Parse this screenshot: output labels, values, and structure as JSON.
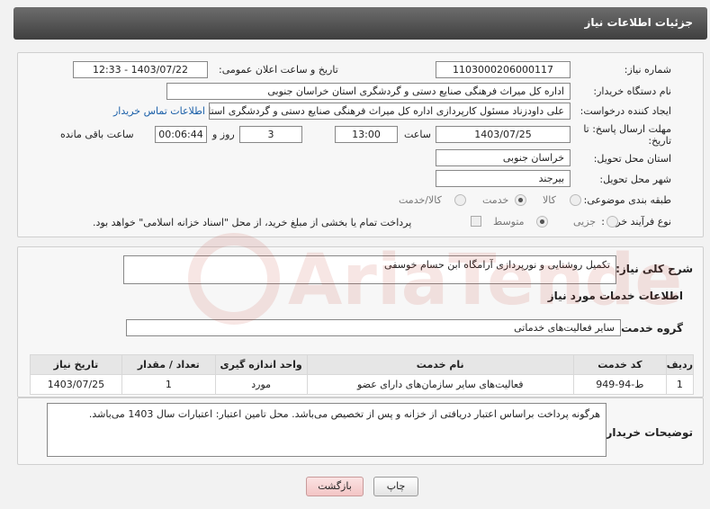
{
  "header": {
    "title": "جزئیات اطلاعات نیاز"
  },
  "form": {
    "need_number_label": "شماره نیاز:",
    "need_number": "1103000206000117",
    "announce_label": "تاریخ و ساعت اعلان عمومی:",
    "announce_value": "1403/07/22 - 12:33",
    "buyer_org_label": "نام دستگاه خریدار:",
    "buyer_org": "اداره کل میراث فرهنگی  صنایع دستی و گردشگری استان خراسان جنوبی",
    "creator_label": "ایجاد کننده درخواست:",
    "creator": "علی داودزناد مسئول کارپردازی اداره کل میراث فرهنگی  صنایع دستی و گردشگری استان خراسان جنوبی",
    "contact_link": "اطلاعات تماس خریدار",
    "deadline_label_1": "مهلت ارسال پاسخ: تا",
    "deadline_label_2": "تاریخ:",
    "deadline_date": "1403/07/25",
    "time_label": "ساعت",
    "deadline_time": "13:00",
    "days_value": "3",
    "days_label": "روز و",
    "remaining_time": "00:06:44",
    "remaining_label": "ساعت باقی مانده",
    "province_label": "استان محل تحویل:",
    "province": "خراسان جنوبی",
    "city_label": "شهر محل تحویل:",
    "city": "بیرجند",
    "category_label": "طبقه بندی موضوعی:",
    "category_options": [
      "کالا",
      "خدمت",
      "کالا/خدمت"
    ],
    "category_selected": 1,
    "process_label": "نوع فرآیند خرید :",
    "process_options": [
      "جزیی",
      "متوسط"
    ],
    "process_selected": 1,
    "payment_text": "پرداخت تمام یا بخشی از مبلغ خرید، از محل \"اسناد خزانه اسلامی\" خواهد بود."
  },
  "summary": {
    "label": "شرح کلی نیاز:",
    "value": "تکمیل روشنایی و نورپردازی آرامگاه ابن حسام خوسفی"
  },
  "services": {
    "section_title": "اطلاعات خدمات مورد نیاز",
    "group_label": "گروه خدمت:",
    "group_value": "سایر فعالیت‌های خدماتی",
    "columns": [
      "ردیف",
      "کد خدمت",
      "نام خدمت",
      "واحد اندازه گیری",
      "تعداد / مقدار",
      "تاریخ نیاز"
    ],
    "rows": [
      {
        "row": "1",
        "code": "ط-94-949",
        "name": "فعالیت‌های سایر سازمان‌های دارای عضو",
        "unit": "مورد",
        "qty": "1",
        "date": "1403/07/25"
      }
    ]
  },
  "buyer_notes": {
    "label": "توضیحات خریدار:",
    "value": "هرگونه پرداخت براساس اعتبار دریافتی از خزانه و پس از تخصیص می‌باشد. محل تامین اعتبار: اعتبارات سال 1403 می‌باشد."
  },
  "buttons": {
    "print": "چاپ",
    "back": "بازگشت"
  },
  "watermark": {
    "text": "AriaTender.neT"
  },
  "colors": {
    "header": "#4f4f4f",
    "link": "#1a5fa8",
    "back_button": "#f7d2d2"
  }
}
